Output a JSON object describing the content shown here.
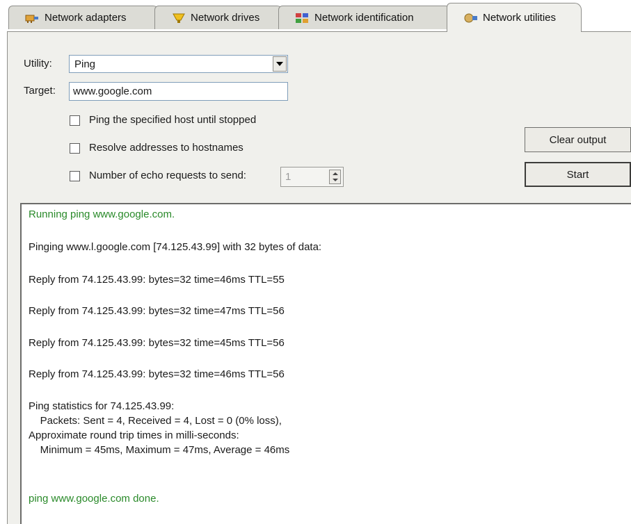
{
  "tabs": [
    {
      "label": "Network adapters",
      "icon": "network-adapters-icon",
      "active": false
    },
    {
      "label": "Network drives",
      "icon": "network-drives-icon",
      "active": false
    },
    {
      "label": "Network identification",
      "icon": "network-identification-icon",
      "active": false
    },
    {
      "label": "Network utilities",
      "icon": "network-utilities-icon",
      "active": true
    }
  ],
  "form": {
    "utility_label": "Utility:",
    "utility_value": "Ping",
    "target_label": "Target:",
    "target_value": "www.google.com",
    "options": [
      {
        "label": "Ping the specified host until stopped",
        "checked": false
      },
      {
        "label": "Resolve addresses to hostnames",
        "checked": false
      },
      {
        "label": "Number of echo requests to send:",
        "checked": false
      }
    ],
    "echo_count": "1"
  },
  "buttons": {
    "clear": "Clear output",
    "start": "Start"
  },
  "output": {
    "lines": [
      {
        "text": "Running ping www.google.com.",
        "color": "#2a8a2a"
      },
      {
        "text": "Pinging www.l.google.com [74.125.43.99] with 32 bytes of data:",
        "color": "#1a1a1a"
      },
      {
        "text": "Reply from 74.125.43.99: bytes=32 time=46ms TTL=55",
        "color": "#1a1a1a"
      },
      {
        "text": "Reply from 74.125.43.99: bytes=32 time=47ms TTL=56",
        "color": "#1a1a1a"
      },
      {
        "text": "Reply from 74.125.43.99: bytes=32 time=45ms TTL=56",
        "color": "#1a1a1a"
      },
      {
        "text": "Reply from 74.125.43.99: bytes=32 time=46ms TTL=56",
        "color": "#1a1a1a"
      },
      {
        "text": "Ping statistics for 74.125.43.99:",
        "color": "#1a1a1a"
      },
      {
        "text": "    Packets: Sent = 4, Received = 4, Lost = 0 (0% loss),",
        "color": "#1a1a1a"
      },
      {
        "text": "Approximate round trip times in milli-seconds:",
        "color": "#1a1a1a"
      },
      {
        "text": "    Minimum = 45ms, Maximum = 47ms, Average = 46ms",
        "color": "#1a1a1a"
      },
      {
        "text": "ping www.google.com done.",
        "color": "#2a8a2a"
      }
    ]
  }
}
